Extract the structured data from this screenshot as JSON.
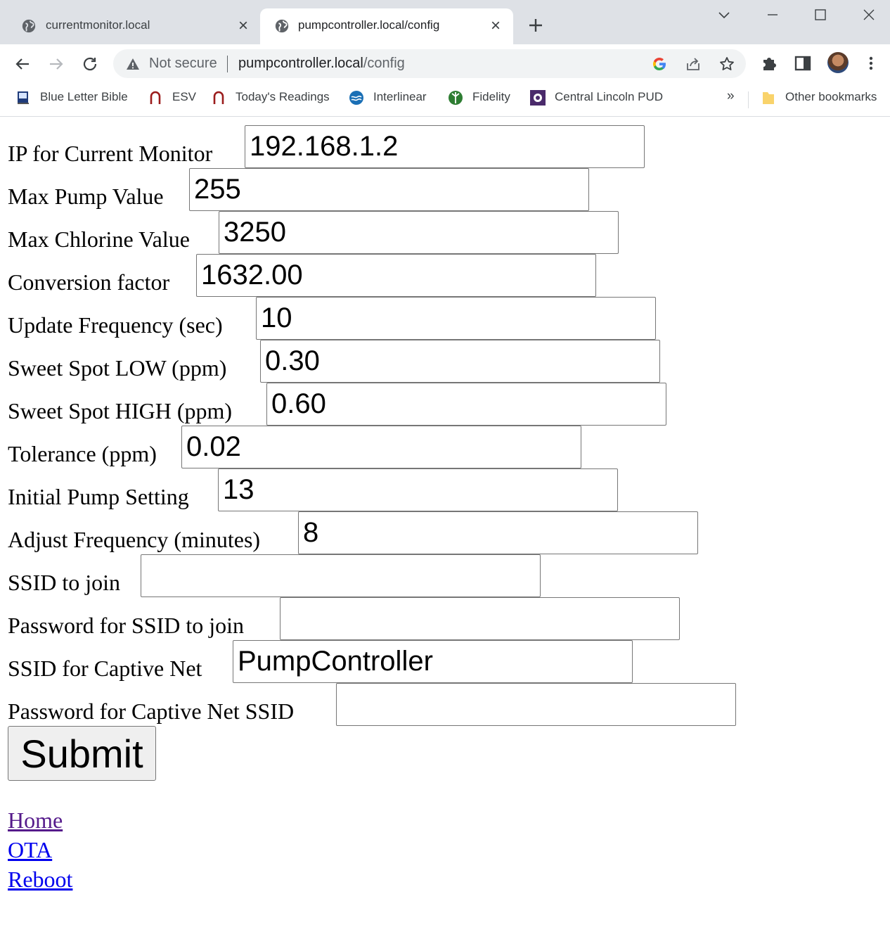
{
  "browser": {
    "tabs": [
      {
        "title": "currentmonitor.local",
        "active": false
      },
      {
        "title": "pumpcontroller.local/config",
        "active": true
      }
    ],
    "address_bar": {
      "security_label": "Not secure",
      "url_host": "pumpcontroller.local",
      "url_path": "/config"
    },
    "bookmarks": [
      {
        "label": "Blue Letter Bible",
        "icon": "bible-icon"
      },
      {
        "label": "ESV",
        "icon": "esv-icon"
      },
      {
        "label": "Today's Readings",
        "icon": "readings-icon"
      },
      {
        "label": "Interlinear",
        "icon": "interlinear-icon"
      },
      {
        "label": "Fidelity",
        "icon": "fidelity-icon"
      },
      {
        "label": "Central Lincoln PUD",
        "icon": "pud-icon"
      }
    ],
    "bookmarks_overflow": "»",
    "other_bookmarks": "Other bookmarks"
  },
  "form": {
    "fields": [
      {
        "label": "IP for Current Monitor",
        "value": "192.168.1.2"
      },
      {
        "label": "Max Pump Value",
        "value": "255"
      },
      {
        "label": "Max Chlorine Value",
        "value": "3250"
      },
      {
        "label": "Conversion factor",
        "value": "1632.00"
      },
      {
        "label": "Update Frequency (sec)",
        "value": "10"
      },
      {
        "label": "Sweet Spot LOW (ppm)",
        "value": "0.30"
      },
      {
        "label": "Sweet Spot HIGH (ppm)",
        "value": "0.60"
      },
      {
        "label": "Tolerance (ppm)",
        "value": "0.02"
      },
      {
        "label": "Initial Pump Setting",
        "value": "13"
      },
      {
        "label": "Adjust Frequency (minutes)",
        "value": "8"
      },
      {
        "label": "SSID to join",
        "value": ""
      },
      {
        "label": "Password for SSID to join",
        "value": ""
      },
      {
        "label": "SSID for Captive Net",
        "value": "PumpController"
      },
      {
        "label": "Password for Captive Net SSID",
        "value": ""
      }
    ],
    "submit_label": "Submit"
  },
  "links": [
    {
      "label": "Home",
      "visited": true
    },
    {
      "label": "OTA",
      "visited": false
    },
    {
      "label": "Reboot",
      "visited": false
    }
  ],
  "colors": {
    "link": "#0000ee",
    "visited_link": "#551a8b",
    "chrome_frame": "#dee1e6"
  }
}
